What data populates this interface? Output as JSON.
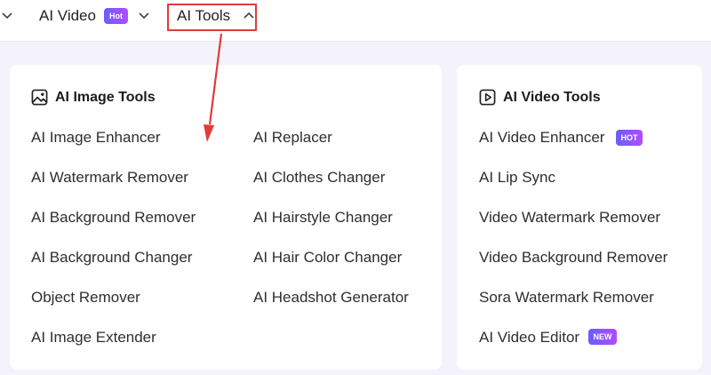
{
  "nav": {
    "ai_video_label": "AI Video",
    "ai_video_badge": "Hot",
    "ai_tools_label": "AI Tools"
  },
  "image_tools": {
    "title": "AI Image Tools",
    "col1": [
      "AI Image Enhancer",
      "AI Watermark Remover",
      "AI Background Remover",
      "AI Background Changer",
      "Object Remover",
      "AI Image Extender"
    ],
    "col2": [
      "AI Replacer",
      "AI Clothes Changer",
      "AI Hairstyle Changer",
      "AI Hair Color Changer",
      "AI Headshot Generator"
    ]
  },
  "video_tools": {
    "title": "AI Video Tools",
    "items": [
      "AI Video Enhancer",
      "AI Lip Sync",
      "Video Watermark Remover",
      "Video Background Remover",
      "Sora Watermark Remover",
      "AI Video Editor"
    ],
    "badge_hot": "HOT",
    "badge_new": "NEW"
  },
  "colors": {
    "highlight_red": "#e23b3b",
    "badge_purple": "#8a55ff",
    "dropdown_bg": "#f4f3fb"
  }
}
